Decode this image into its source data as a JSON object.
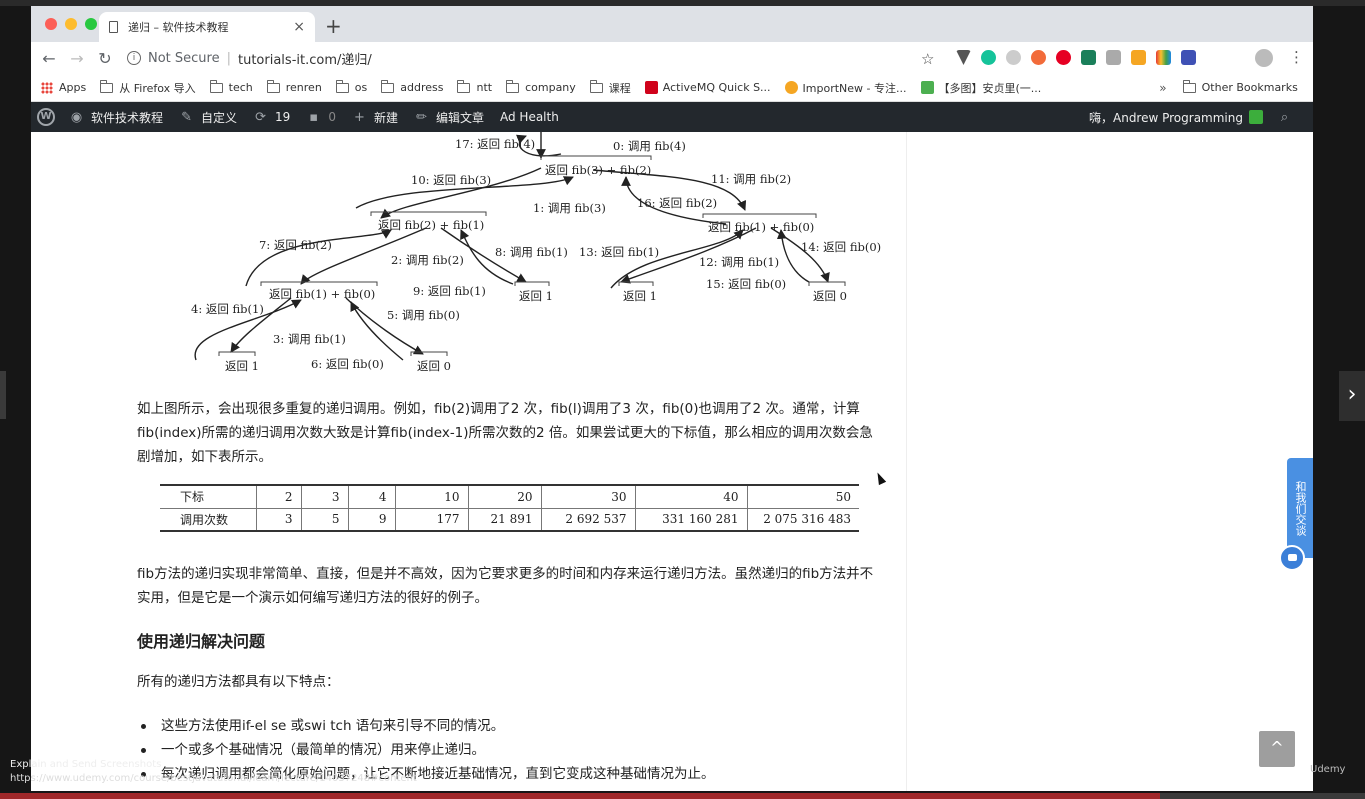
{
  "tab": {
    "title": "递归 – 软件技术教程",
    "close": "×",
    "new": "+"
  },
  "address": {
    "not_secure": "Not Secure",
    "url": "tutorials-it.com/递归/"
  },
  "bookmarks": {
    "apps": "Apps",
    "items": [
      "从 Firefox 导入",
      "tech",
      "renren",
      "os",
      "address",
      "ntt",
      "company",
      "课程",
      "ActiveMQ Quick S...",
      "ImportNew - 专注...",
      "【多图】安贞里(一..."
    ],
    "more": "»",
    "other": "Other Bookmarks"
  },
  "wpbar": {
    "site": "软件技术教程",
    "customize": "自定义",
    "updates": "19",
    "comments": "0",
    "new": "新建",
    "edit": "编辑文章",
    "ad_health": "Ad Health",
    "greeting": "嗨，Andrew Programming"
  },
  "tree": {
    "nodes": {
      "fib3": "返回 fib(3) + fib(2)",
      "fib2": "返回 fib(2) + fib(1)",
      "fib1a": "返回 fib(1) + fib(0)",
      "fib1b": "返回 fib(1) + fib(0)",
      "r1a": "返回 1",
      "r0a": "返回 0",
      "r1b": "返回 1",
      "r1c": "返回 1",
      "r0b": "返回 0"
    },
    "labels": {
      "l17": "17: 返回 fib(4)",
      "l0": "0: 调用 fib(4)",
      "l10": "10: 返回 fib(3)",
      "l11": "11: 调用 fib(2)",
      "l16": "16: 返回 fib(2)",
      "l1": "1: 调用 fib(3)",
      "l7": "7: 返回 fib(2)",
      "l2": "2: 调用 fib(2)",
      "l8": "8: 调用 fib(1)",
      "l13": "13: 返回 fib(1)",
      "l14": "14: 返回 fib(0)",
      "l12": "12: 调用 fib(1)",
      "l9": "9: 返回 fib(1)",
      "l15": "15: 返回 fib(0)",
      "l4": "4: 返回 fib(1)",
      "l5": "5: 调用 fib(0)",
      "l3": "3: 调用 fib(1)",
      "l6": "6: 返回 fib(0)"
    }
  },
  "text": {
    "p1": "如上图所示，会出现很多重复的递归调用。例如，fib(2)调用了2 次，fib(l)调用了3 次，fib(0)也调用了2 次。通常，计算fib(index)所需的递归调用次数大致是计算fib(index-1)所需次数的2 倍。如果尝试更大的下标值，那么相应的调用次数会急剧增加，如下表所示。",
    "p2": "fib方法的递归实现非常简单、直接，但是并不高效，因为它要求更多的时间和内存来运行递归方法。虽然递归的fib方法并不实用，但是它是一个演示如何编写递归方法的很好的例子。",
    "h3": "使用递归解决问题",
    "p3": "所有的递归方法都具有以下特点：",
    "bullets": [
      "这些方法使用if-el se 或swi tch 语句来引导不同的情况。",
      "一个或多个基础情况（最简单的情况）用来停止递归。",
      "每次递归调用都会简化原始问题，让它不断地接近基础情况，直到它变成这种基础情况为止。"
    ]
  },
  "table": {
    "row1_label": "下标",
    "row2_label": "调用次数",
    "index": [
      "2",
      "3",
      "4",
      "10",
      "20",
      "30",
      "40",
      "50"
    ],
    "calls": [
      "3",
      "5",
      "9",
      "177",
      "21 891",
      "2 692 537",
      "331 160 281",
      "2 075 316 483"
    ]
  },
  "widgets": {
    "contact": "和我们交谈",
    "scroll_top": "^"
  },
  "overlay": {
    "explain": "Explain and Send Screenshots",
    "link": "https://www.udemy.com/course/bestjavatutorial/learn/lecture/14037248#content",
    "udemy": "Udemy"
  },
  "colors": {
    "wpbar": "#23282d",
    "progress": "#a0282a",
    "contact": "#4a90e2"
  },
  "video_progress": 0.85
}
